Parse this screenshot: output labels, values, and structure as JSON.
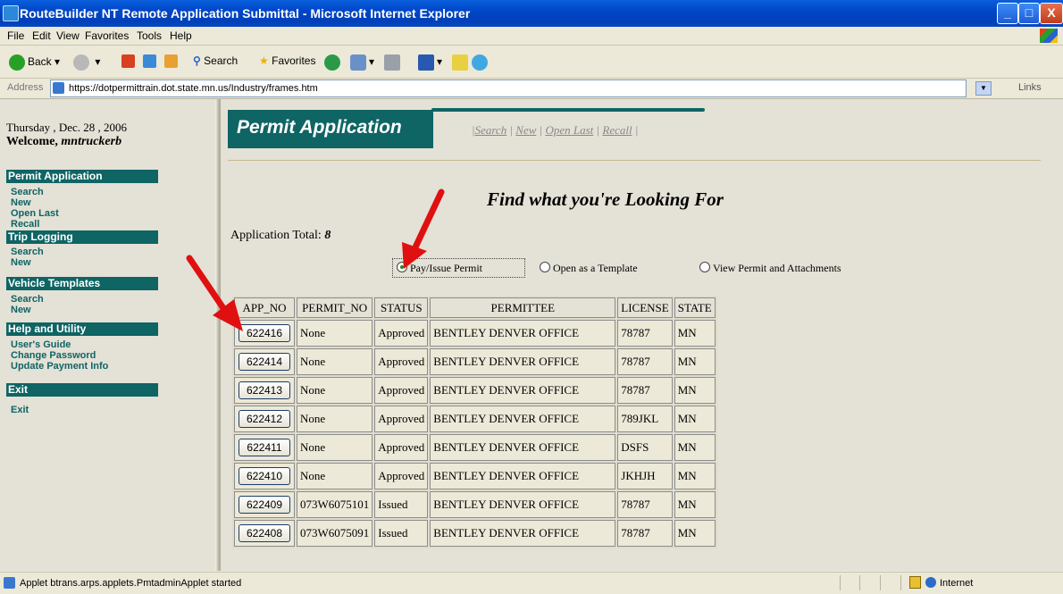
{
  "window": {
    "title": "RouteBuilder NT Remote Application Submittal - Microsoft Internet Explorer",
    "min": "_",
    "max": "□",
    "close": "X"
  },
  "menu": [
    "File",
    "Edit",
    "View",
    "Favorites",
    "Tools",
    "Help"
  ],
  "toolbar": {
    "back": "Back",
    "search": "Search",
    "favorites": "Favorites"
  },
  "address": {
    "label": "Address",
    "url": "https://dotpermittrain.dot.state.mn.us/Industry/frames.htm",
    "links": "Links"
  },
  "sidebar": {
    "date": "Thursday , Dec. 28 , 2006",
    "welcome_prefix": "Welcome, ",
    "user": "mntruckerb",
    "sections": [
      {
        "title": "Permit Application",
        "items": [
          "Search",
          "New",
          "Open Last",
          "Recall"
        ]
      },
      {
        "title": "Trip Logging",
        "items": [
          "Search",
          "New"
        ]
      },
      {
        "title": "Vehicle Templates",
        "items": [
          "Search",
          "New"
        ]
      },
      {
        "title": "Help and Utility",
        "items": [
          "User's Guide",
          "Change Password",
          "Update Payment Info"
        ]
      },
      {
        "title": "Exit",
        "items": [
          "Exit"
        ]
      }
    ]
  },
  "main": {
    "banner_title": "Permit Application",
    "banner_links": [
      "Search",
      "New",
      "Open Last",
      "Recall"
    ],
    "heading": "Find what you're Looking For",
    "app_total_label": "Application Total: ",
    "app_total_value": "8",
    "radios": [
      {
        "label": "Pay/Issue Permit",
        "selected": true
      },
      {
        "label": "Open as a Template",
        "selected": false
      },
      {
        "label": "View Permit and Attachments",
        "selected": false
      }
    ],
    "table": {
      "headers": [
        "APP_NO",
        "PERMIT_NO",
        "STATUS",
        "PERMITTEE",
        "LICENSE",
        "STATE"
      ],
      "rows": [
        [
          "622416",
          "None",
          "Approved",
          "BENTLEY DENVER OFFICE",
          "78787",
          "MN"
        ],
        [
          "622414",
          "None",
          "Approved",
          "BENTLEY DENVER OFFICE",
          "78787",
          "MN"
        ],
        [
          "622413",
          "None",
          "Approved",
          "BENTLEY DENVER OFFICE",
          "78787",
          "MN"
        ],
        [
          "622412",
          "None",
          "Approved",
          "BENTLEY DENVER OFFICE",
          "789JKL",
          "MN"
        ],
        [
          "622411",
          "None",
          "Approved",
          "BENTLEY DENVER OFFICE",
          "DSFS",
          "MN"
        ],
        [
          "622410",
          "None",
          "Approved",
          "BENTLEY DENVER OFFICE",
          "JKHJH",
          "MN"
        ],
        [
          "622409",
          "073W6075101",
          "Issued",
          "BENTLEY DENVER OFFICE",
          "78787",
          "MN"
        ],
        [
          "622408",
          "073W6075091",
          "Issued",
          "BENTLEY DENVER OFFICE",
          "78787",
          "MN"
        ]
      ]
    }
  },
  "status": {
    "text": "Applet btrans.arps.applets.PmtadminApplet started",
    "zone": "Internet"
  },
  "colors": {
    "accent": "#0f6464",
    "arrow": "#e01010"
  }
}
